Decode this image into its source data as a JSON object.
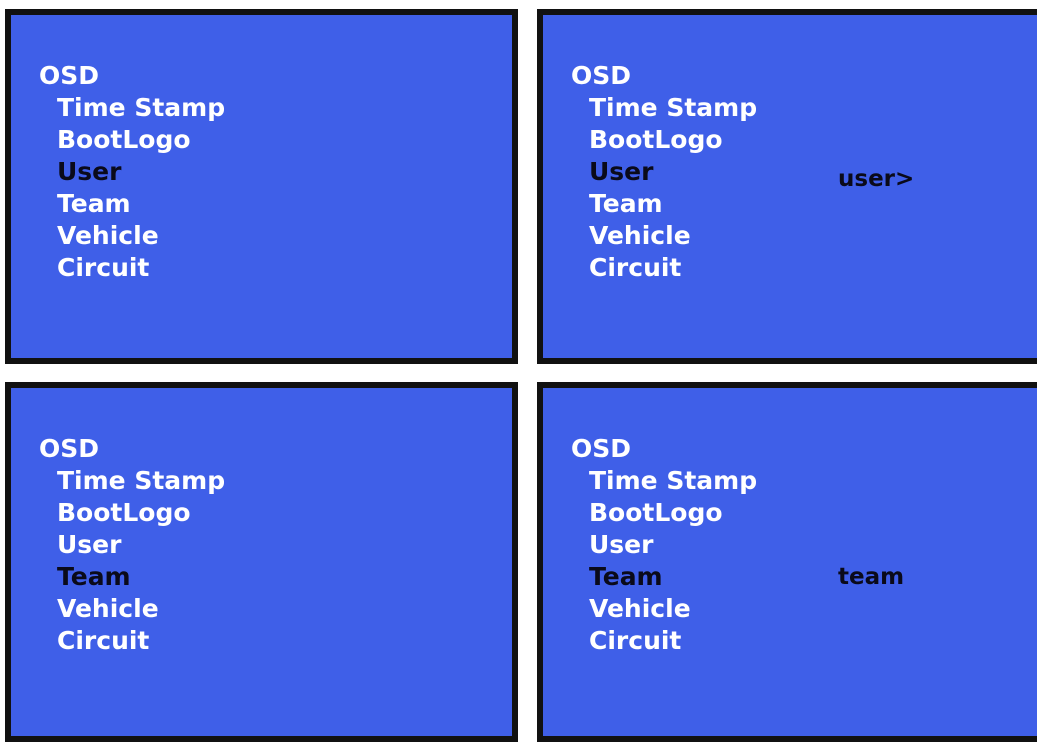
{
  "screens": [
    {
      "title": "OSD",
      "items": [
        "Time Stamp",
        "BootLogo",
        "User",
        "Team",
        "Vehicle",
        "Circuit"
      ],
      "selected": "User",
      "prompt": ""
    },
    {
      "title": "OSD",
      "items": [
        "Time Stamp",
        "BootLogo",
        "User",
        "Team",
        "Vehicle",
        "Circuit"
      ],
      "selected": "User",
      "prompt": "user>"
    },
    {
      "title": "OSD",
      "items": [
        "Time Stamp",
        "BootLogo",
        "User",
        "Team",
        "Vehicle",
        "Circuit"
      ],
      "selected": "Team",
      "prompt": ""
    },
    {
      "title": "OSD",
      "items": [
        "Time Stamp",
        "BootLogo",
        "User",
        "Team",
        "Vehicle",
        "Circuit"
      ],
      "selected": "Team",
      "prompt": "team"
    }
  ],
  "colors": {
    "screen_background": "#3f5fe8",
    "menu_text": "#ffffff",
    "selected_text": "#0a0a1a",
    "frame_border": "#111111"
  }
}
